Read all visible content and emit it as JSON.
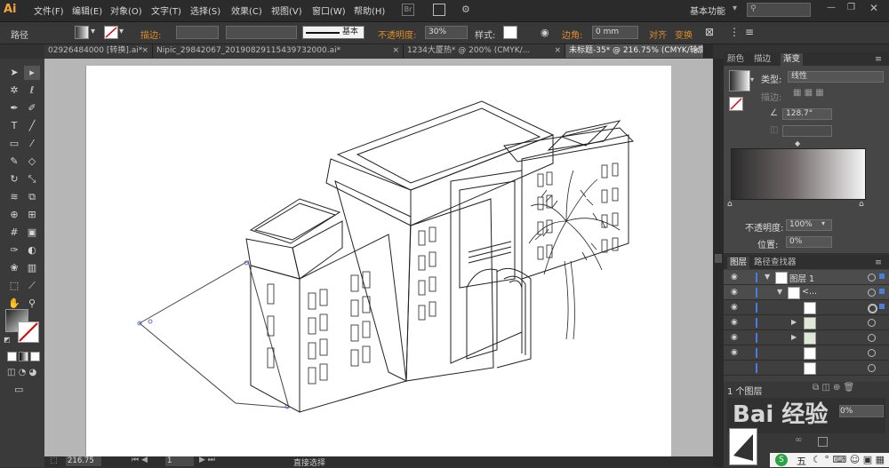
{
  "app": {
    "logo": "Ai"
  },
  "menu": {
    "items": [
      "文件(F)",
      "编辑(E)",
      "对象(O)",
      "文字(T)",
      "选择(S)",
      "效果(C)",
      "视图(V)",
      "窗口(W)",
      "帮助(H)"
    ],
    "bridge_icon": "Br",
    "workspace": "基本功能"
  },
  "control": {
    "selection_label": "路径",
    "stroke_label": "描边:",
    "brush_label": "基本",
    "opacity_label": "不透明度:",
    "opacity_value": "30%",
    "style_label": "样式:",
    "corner_label": "边角:",
    "corner_value": "0 mm",
    "align_label": "对齐",
    "transform_label": "变换"
  },
  "tabs": [
    {
      "label": "02926484000 [转换].ai*",
      "close": "×"
    },
    {
      "label": "Nipic_29842067_20190829115439732000.ai*",
      "close": "×"
    },
    {
      "label": "1234大厦热* @ 200% (CMYK/...",
      "close": "×"
    },
    {
      "label": "未标题-35* @ 216.75% (CMYK/轮廓)",
      "close": "×",
      "active": true
    }
  ],
  "gradient_panel": {
    "tabs": [
      "颜色",
      "描边",
      "渐变"
    ],
    "type_label": "类型:",
    "type_value": "线性",
    "stroke_label": "描边:",
    "angle_value": "128.7°",
    "opacity_label": "不透明度:",
    "opacity_value": "100%",
    "location_label": "位置:",
    "location_value": "0%",
    "ramp_colors": [
      "#2b2b2b",
      "#6e6666",
      "#f4f4f4"
    ]
  },
  "layers_panel": {
    "tabs": [
      "图层",
      "路径查找器"
    ],
    "rows": [
      {
        "name": "图层 1",
        "indent": 0,
        "has_arrow": true
      },
      {
        "name": "<...",
        "indent": 1,
        "has_arrow": true
      },
      {
        "name": "",
        "indent": 2
      },
      {
        "name": "",
        "indent": 2,
        "has_arrow": true
      },
      {
        "name": "",
        "indent": 2,
        "has_arrow": true
      },
      {
        "name": "",
        "indent": 2
      },
      {
        "name": "",
        "indent": 2
      }
    ],
    "count_label": "1 个图层"
  },
  "statusbar": {
    "zoom": "216.75",
    "page": "1",
    "mode": "直接选择"
  },
  "watermark": "Bai 经验",
  "ime": {
    "label": "五"
  },
  "icons": [
    "selection-tool",
    "direct-selection-tool",
    "magic-wand",
    "lasso",
    "pen",
    "curvature",
    "type",
    "line",
    "rectangle",
    "paintbrush",
    "pencil",
    "eraser",
    "rotate",
    "scale",
    "width",
    "free-transform",
    "shape-builder",
    "perspective",
    "mesh",
    "gradient",
    "eyedropper",
    "blend",
    "symbol-sprayer",
    "column-graph",
    "artboard",
    "slice",
    "hand",
    "zoom"
  ]
}
